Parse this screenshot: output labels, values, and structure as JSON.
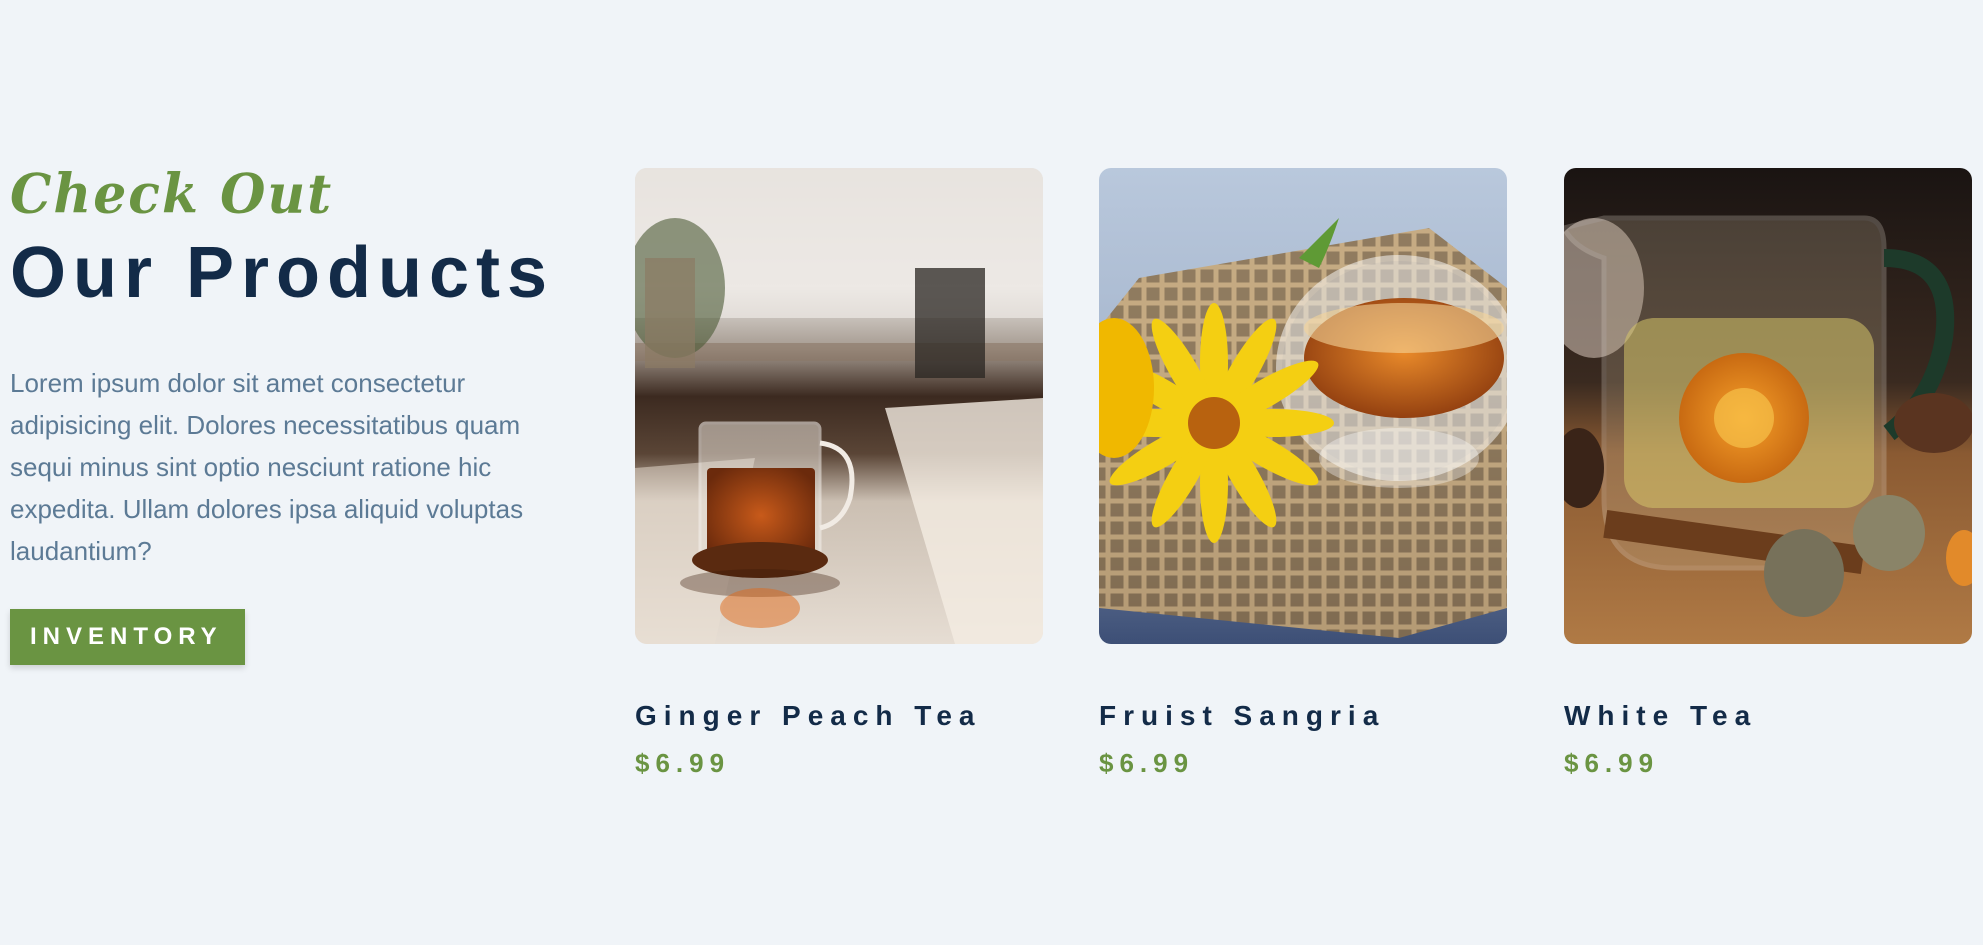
{
  "intro": {
    "kicker": "Check Out",
    "title": "Our Products",
    "description": "Lorem ipsum dolor sit amet consectetur adipisicing elit. Dolores necessitatibus quam sequi minus sint optio nesciunt ratione hic expedita. Ullam dolores ipsa aliquid voluptas laudantium?",
    "button_label": "INVENTORY"
  },
  "products": [
    {
      "name": "Ginger Peach Tea",
      "price": "$6.99",
      "image": "glass-tea-cup-photo"
    },
    {
      "name": "Fruist Sangria",
      "price": "$6.99",
      "image": "tea-bowl-with-flowers-photo"
    },
    {
      "name": "White Tea",
      "price": "$6.99",
      "image": "blooming-tea-pot-photo"
    }
  ],
  "colors": {
    "background": "#f0f4f8",
    "accent_green": "#6a9442",
    "navy": "#132b48",
    "text_muted": "#5c7a95"
  }
}
